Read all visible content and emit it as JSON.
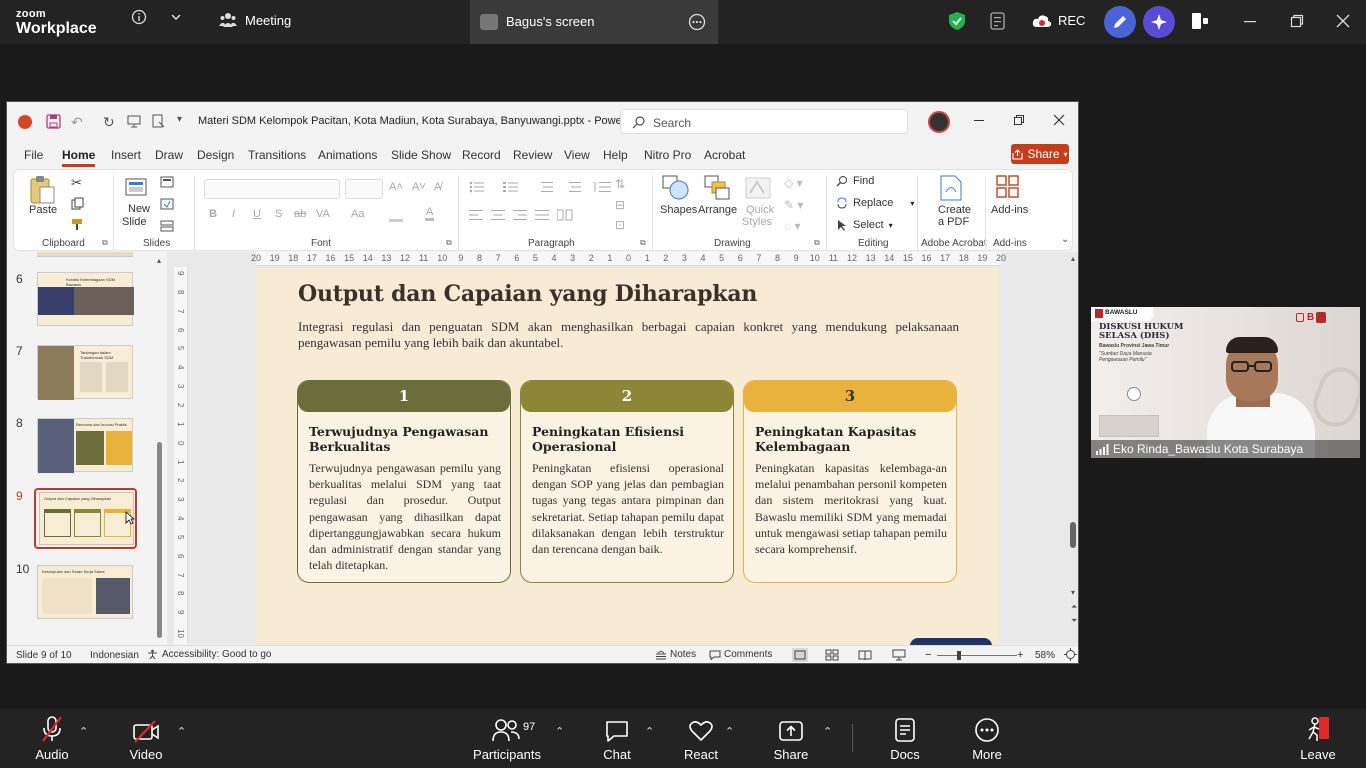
{
  "zoom": {
    "brand_top": "zoom",
    "brand_bottom": "Workplace",
    "meeting_tab": "Meeting",
    "screen_tab": "Bagus's screen",
    "rec_label": "REC",
    "bottom": {
      "audio": "Audio",
      "video": "Video",
      "participants": "Participants",
      "participants_count": "97",
      "chat": "Chat",
      "react": "React",
      "share": "Share",
      "docs": "Docs",
      "more": "More",
      "leave": "Leave"
    },
    "video_tile": {
      "name": "Eko Rinda_Bawaslu Kota Surabaya",
      "banner_org": "BAWASLU",
      "banner_title": "DISKUSI HUKUM SELASA (DHS)",
      "banner_sub": "Bawaslu Provinsi Jawa Timur",
      "banner_quote": "\"Sumber Daya Manusia Pengawasan Pemilu\""
    }
  },
  "ppt": {
    "title": "Materi SDM Kelompok Pacitan, Kota Madiun, Kota Surabaya, Banyuwangi.pptx  -  PowerP...",
    "search_placeholder": "Search",
    "menu": [
      "File",
      "Home",
      "Insert",
      "Draw",
      "Design",
      "Transitions",
      "Animations",
      "Slide Show",
      "Record",
      "Review",
      "View",
      "Help",
      "Nitro Pro",
      "Acrobat"
    ],
    "share_label": "Share",
    "ribbon": {
      "paste": "Paste",
      "clipboard": "Clipboard",
      "new_slide_1": "New",
      "new_slide_2": "Slide",
      "slides": "Slides",
      "font": "Font",
      "paragraph": "Paragraph",
      "shapes": "Shapes",
      "arrange": "Arrange",
      "quick_styles_1": "Quick",
      "quick_styles_2": "Styles",
      "drawing": "Drawing",
      "find": "Find",
      "replace": "Replace",
      "select": "Select",
      "editing": "Editing",
      "create_pdf_1": "Create",
      "create_pdf_2": "a PDF",
      "adobe_acrobat": "Adobe Acrobat",
      "addins": "Add-ins",
      "addins_group": "Add-ins",
      "bold": "B",
      "italic": "I",
      "underline": "U",
      "shadow": "S",
      "strike": "ab",
      "font_color": "A"
    },
    "thumbnails": [
      {
        "num": "6",
        "title": "Kondisi Kelembagaan SDM Bawaslu"
      },
      {
        "num": "7",
        "title": "Tantangan dalam Transformasi SDM"
      },
      {
        "num": "8",
        "title": "Rencana dan Inovasi Praktis"
      },
      {
        "num": "9",
        "title": "Output dan Capaian yang Diharapkan"
      },
      {
        "num": "10",
        "title": "Kesimpulan dan Saran Kerja Sama"
      }
    ],
    "ruler_h": [
      "20",
      "19",
      "18",
      "17",
      "16",
      "15",
      "14",
      "13",
      "12",
      "11",
      "10",
      "9",
      "8",
      "7",
      "6",
      "5",
      "4",
      "3",
      "2",
      "1",
      "0",
      "1",
      "2",
      "3",
      "4",
      "5",
      "6",
      "7",
      "8",
      "9",
      "10",
      "11",
      "12",
      "13",
      "14",
      "15",
      "16",
      "17",
      "18",
      "19",
      "20"
    ],
    "ruler_v": [
      "9",
      "8",
      "7",
      "6",
      "5",
      "4",
      "3",
      "2",
      "1",
      "0",
      "1",
      "2",
      "3",
      "4",
      "5",
      "6",
      "7",
      "8",
      "9",
      "10"
    ],
    "slide": {
      "title": "Output dan Capaian yang Diharapkan",
      "intro": "Integrasi regulasi dan penguatan SDM akan menghasilkan berbagai capaian konkret yang mendukung pelaksanaan pengawasan pemilu yang lebih baik dan akuntabel.",
      "cards": [
        {
          "num": "1",
          "title": "Terwujudnya Pengawasan Berkualitas",
          "body": "Terwujudnya pengawasan pemilu yang berkualitas melalui SDM yang taat regulasi dan prosedur. Output pengawasan yang dihasilkan dapat dipertanggungjawabkan secara hukum dan administratif dengan standar yang telah ditetapkan."
        },
        {
          "num": "2",
          "title": "Peningkatan Efisiensi Operasional",
          "body": "Peningkatan efisiensi operasional dengan SOP yang jelas dan pembagian tugas yang tegas antara pimpinan dan sekretariat. Setiap tahapan pemilu dapat dilaksanakan dengan lebih terstruktur dan terencana dengan baik."
        },
        {
          "num": "3",
          "title": "Peningkatan Kapasitas Kelembagaan",
          "body": "Peningkatan kapasitas kelembaga-an melalui penambahan personil kompeten dan sistem meritokrasi yang kuat. Bawaslu memiliki SDM yang memadai untuk mengawasi setiap tahapan pemilu secara komprehensif."
        }
      ]
    },
    "status": {
      "slide_of": "Slide 9 of 10",
      "language": "Indonesian",
      "accessibility": "Accessibility: Good to go",
      "notes": "Notes",
      "comments": "Comments",
      "zoom": "58%"
    }
  },
  "colors": {
    "card1": "#6b6e3a",
    "card2": "#8c8737",
    "card3": "#e9b23d",
    "slide_bg": "#f7ebd5",
    "zoom_bar": "#232323"
  }
}
